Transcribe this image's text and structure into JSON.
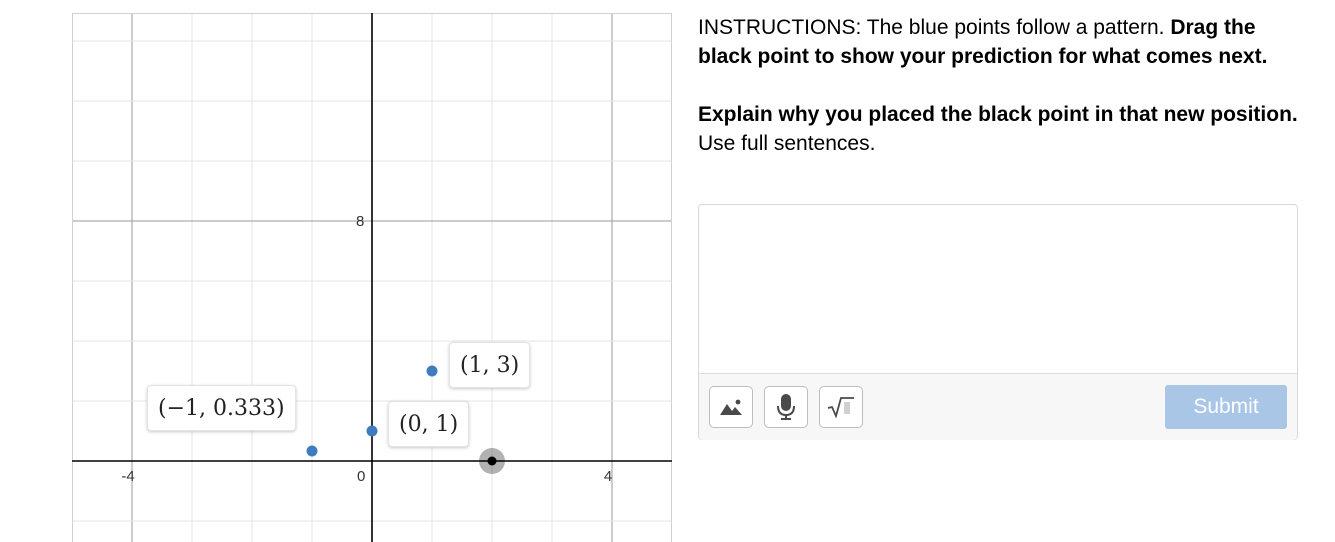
{
  "graph": {
    "x_tick_labels": [
      "-4",
      "0",
      "4"
    ],
    "y_tick_labels": [
      "8"
    ],
    "points": [
      {
        "x": -1,
        "y": 0.333,
        "color": "#3f7dbf",
        "label": "(−1, 0.333)"
      },
      {
        "x": 0,
        "y": 1,
        "color": "#3f7dbf",
        "label": "(0, 1)"
      },
      {
        "x": 1,
        "y": 3,
        "color": "#3f7dbf",
        "label": "(1, 3)"
      }
    ],
    "draggable_point": {
      "x": 2,
      "y": 0,
      "color": "#000000"
    }
  },
  "instructions": {
    "line1_prefix": "INSTRUCTIONS: The blue points follow a pattern.",
    "line1_bold": "Drag the black point to show your prediction for what comes next.",
    "line2_bold": "Explain why you placed the black point in that new position.",
    "line2_rest": " Use full sentences."
  },
  "answer": {
    "value": "",
    "tools": [
      "image-icon",
      "microphone-icon",
      "square-root-icon"
    ],
    "submit_label": "Submit"
  },
  "colors": {
    "accent": "#a9c6e6",
    "blue_point": "#3f7dbf",
    "grid": "#e6e6e6",
    "axis": "#000000"
  }
}
